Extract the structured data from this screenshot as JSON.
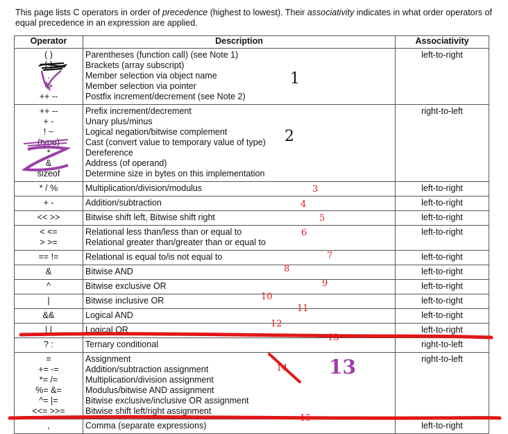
{
  "intro": {
    "part1": "This page lists C operators in order of ",
    "em1": "precedence",
    "part2": " (highest to lowest). Their ",
    "em2": "associativity",
    "part3": " indicates in what order operators of equal precedence in an expression are applied."
  },
  "table": {
    "headers": [
      "Operator",
      "Description",
      "Associativity"
    ],
    "rows": [
      {
        "ops": [
          "( )",
          "[ ]",
          ".",
          "->",
          "++ --"
        ],
        "desc": [
          "Parentheses (function call) (see Note 1)",
          "Brackets (array subscript)",
          "Member selection via object name",
          "Member selection via pointer",
          "Postfix increment/decrement (see Note 2)"
        ],
        "assoc": "left-to-right"
      },
      {
        "ops": [
          "++ --",
          "+ -",
          "! ~",
          "(type)",
          "*",
          "&",
          "sizeof"
        ],
        "desc": [
          "Prefix increment/decrement",
          "Unary plus/minus",
          "Logical negation/bitwise complement",
          "Cast (convert value to temporary value of type)",
          "Dereference",
          "Address (of operand)",
          "Determine size in bytes on this implementation"
        ],
        "assoc": "right-to-left"
      },
      {
        "ops": [
          "*  /  %"
        ],
        "desc": [
          "Multiplication/division/modulus"
        ],
        "assoc": "left-to-right"
      },
      {
        "ops": [
          "+  -"
        ],
        "desc": [
          "Addition/subtraction"
        ],
        "assoc": "left-to-right"
      },
      {
        "ops": [
          "<<  >>"
        ],
        "desc": [
          "Bitwise shift left, Bitwise shift right"
        ],
        "assoc": "left-to-right"
      },
      {
        "ops": [
          "<  <=",
          ">  >="
        ],
        "desc": [
          "Relational less than/less than or equal to",
          "Relational greater than/greater than or equal to"
        ],
        "assoc": "left-to-right"
      },
      {
        "ops": [
          "==  !="
        ],
        "desc": [
          "Relational is equal to/is not equal to"
        ],
        "assoc": "left-to-right"
      },
      {
        "ops": [
          "&"
        ],
        "desc": [
          "Bitwise AND"
        ],
        "assoc": "left-to-right"
      },
      {
        "ops": [
          "^"
        ],
        "desc": [
          "Bitwise exclusive OR"
        ],
        "assoc": "left-to-right"
      },
      {
        "ops": [
          "|"
        ],
        "desc": [
          "Bitwise inclusive OR"
        ],
        "assoc": "left-to-right"
      },
      {
        "ops": [
          "&&"
        ],
        "desc": [
          "Logical AND"
        ],
        "assoc": "left-to-right"
      },
      {
        "ops": [
          "| |"
        ],
        "desc": [
          "Logical OR"
        ],
        "assoc": "left-to-right"
      },
      {
        "ops": [
          "? :"
        ],
        "desc": [
          "Ternary conditional"
        ],
        "assoc": "right-to-left"
      },
      {
        "ops": [
          "=",
          "+=  -=",
          "*=  /=",
          "%=  &=",
          "^=  |=",
          "<<=  >>="
        ],
        "desc": [
          "Assignment",
          "Addition/subtraction assignment",
          "Multiplication/division assignment",
          "Modulus/bitwise AND assignment",
          "Bitwise exclusive/inclusive OR assignment",
          "Bitwise shift left/right assignment"
        ],
        "assoc": "right-to-left"
      },
      {
        "ops": [
          ","
        ],
        "desc": [
          "Comma (separate expressions)"
        ],
        "assoc": "left-to-right"
      }
    ]
  },
  "annotations": {
    "numbers": [
      "1",
      "2",
      "3",
      "4",
      "5",
      "6",
      "7",
      "8",
      "9",
      "10",
      "11",
      "12",
      "13",
      "14",
      "13",
      "15"
    ],
    "ink_colors": {
      "black": "#111111",
      "red": "#e01818",
      "purple": "#9b3fa8"
    }
  }
}
